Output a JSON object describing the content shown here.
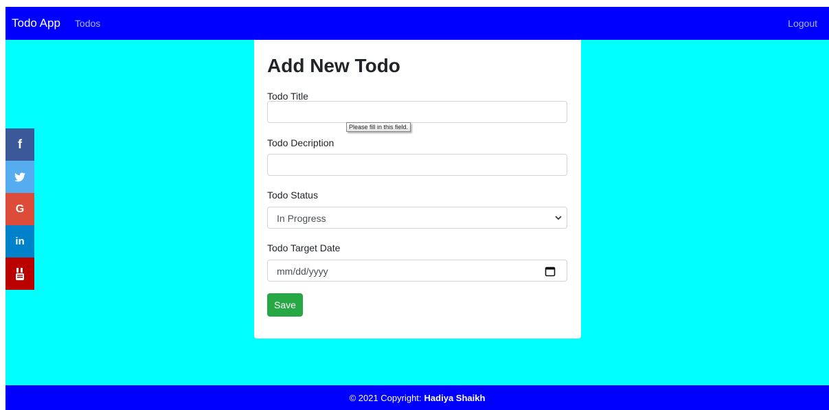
{
  "navbar": {
    "brand": "Todo App",
    "todos_link": "Todos",
    "logout_link": "Logout"
  },
  "social": {
    "items": [
      {
        "icon": "facebook-icon",
        "glyph": "f",
        "color": "#3b5998"
      },
      {
        "icon": "twitter-icon",
        "glyph": "🐦",
        "color": "#55acee"
      },
      {
        "icon": "google-icon",
        "glyph": "G",
        "color": "#dd4b39"
      },
      {
        "icon": "linkedin-icon",
        "glyph": "in",
        "color": "#0082ca"
      },
      {
        "icon": "youtube-icon",
        "glyph": "You Tube",
        "color": "#bb0000"
      }
    ]
  },
  "form": {
    "heading": "Add New Todo",
    "title_label": "Todo Title",
    "title_value": "",
    "validation_tooltip": "Please fill in this field.",
    "description_label": "Todo Decription",
    "description_value": "",
    "status_label": "Todo Status",
    "status_selected": "In Progress",
    "date_label": "Todo Target Date",
    "date_placeholder": "mm/dd/yyyy",
    "save_label": "Save"
  },
  "footer": {
    "copyright": "© 2021 Copyright:",
    "author": "Hadiya Shaikh"
  },
  "colors": {
    "page_bg": "#00ffff",
    "navbar_bg": "#0000ff",
    "footer_bg": "#0000ff",
    "save_button": "#28a745"
  }
}
